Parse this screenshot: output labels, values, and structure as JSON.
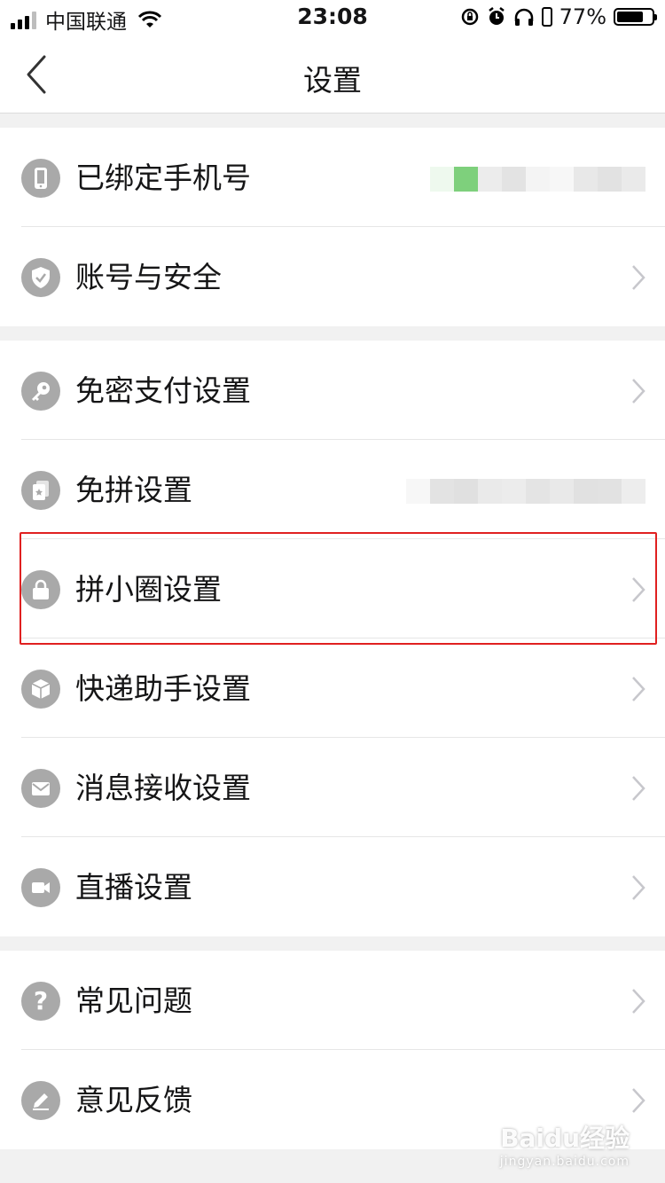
{
  "status_bar": {
    "carrier": "中国联通",
    "time": "23:08",
    "battery_percent": "77%",
    "battery_level": 0.77
  },
  "nav": {
    "title": "设置",
    "back_icon": "chevron-left-icon"
  },
  "groups": [
    {
      "items": [
        {
          "label": "已绑定手机号",
          "icon": "phone-icon",
          "value": "blurred"
        },
        {
          "label": "账号与安全",
          "icon": "shield-icon"
        }
      ]
    },
    {
      "items": [
        {
          "label": "免密支付设置",
          "icon": "key-icon"
        },
        {
          "label": "免拼设置",
          "icon": "card-icon",
          "value": "blurred"
        },
        {
          "label": "拼小圈设置",
          "icon": "lock-icon",
          "highlighted": true
        },
        {
          "label": "快递助手设置",
          "icon": "package-icon"
        },
        {
          "label": "消息接收设置",
          "icon": "mail-icon"
        },
        {
          "label": "直播设置",
          "icon": "video-icon"
        }
      ]
    },
    {
      "items": [
        {
          "label": "常见问题",
          "icon": "question-icon"
        },
        {
          "label": "意见反馈",
          "icon": "edit-icon"
        }
      ]
    }
  ],
  "watermark": {
    "text": "Baidu经验",
    "sub": "jingyan.baidu.com"
  },
  "colors": {
    "icon_gray": "#a9a9a9",
    "highlight_red": "#e02020",
    "bound_green": "#7ed07c"
  }
}
